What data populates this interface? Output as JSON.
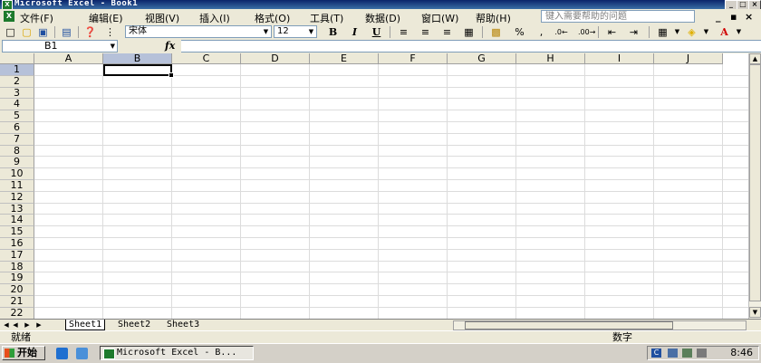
{
  "window": {
    "title": "Microsoft Excel - Book1",
    "app_icon": "excel-icon",
    "controls": [
      "_",
      "□",
      "×"
    ]
  },
  "menu": {
    "items": [
      "文件(F)",
      "编辑(E)",
      "视图(V)",
      "插入(I)",
      "格式(O)",
      "工具(T)",
      "数据(D)",
      "窗口(W)",
      "帮助(H)"
    ],
    "help_placeholder": "键入需要帮助的问题",
    "doc_controls": [
      "_",
      "▪",
      "×"
    ]
  },
  "toolbar": {
    "font_name": "宋体",
    "font_size": "12",
    "bold": "B",
    "italic": "I",
    "underline": "U",
    "percent": "%",
    "comma": ","
  },
  "formula_bar": {
    "name_box": "B1",
    "fx": "fx",
    "value": ""
  },
  "grid": {
    "columns": [
      "A",
      "B",
      "C",
      "D",
      "E",
      "F",
      "G",
      "H",
      "I",
      "J"
    ],
    "rows": [
      "1",
      "2",
      "3",
      "4",
      "5",
      "6",
      "7",
      "8",
      "9",
      "10",
      "11",
      "12",
      "13",
      "14",
      "15",
      "16",
      "17",
      "18",
      "19",
      "20",
      "21",
      "22"
    ],
    "selected_cell": "B1",
    "selected_column": "B",
    "selected_row": "1"
  },
  "sheets": {
    "tabs": [
      "Sheet1",
      "Sheet2",
      "Sheet3"
    ],
    "active": "Sheet1"
  },
  "status": {
    "left": "就绪",
    "right": "数字"
  },
  "taskbar": {
    "start_label": "开始",
    "task_item": "Microsoft Excel - B...",
    "clock": "8:46",
    "tray_label": "C"
  },
  "colors": {
    "title_bar": "#0a246a",
    "chrome": "#ece9d8",
    "selection_header": "#b6c1d9",
    "excel_green": "#1d7a2c"
  }
}
